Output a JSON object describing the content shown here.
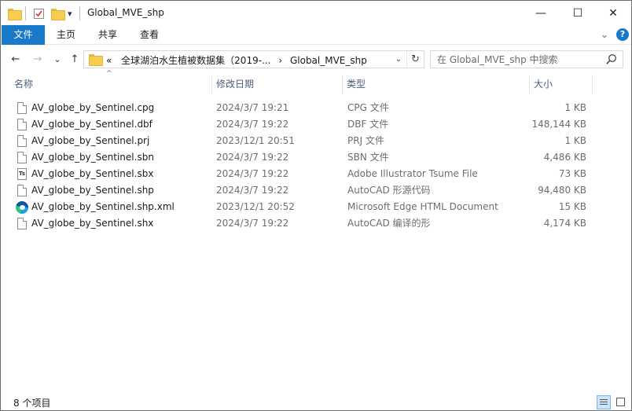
{
  "window": {
    "title": "Global_MVE_shp",
    "minimize_glyph": "—",
    "maximize_glyph": "☐",
    "close_glyph": "✕",
    "help_glyph": "?",
    "collapse_glyph": "⌄"
  },
  "quick_access": {
    "dropdown_glyph": "▾"
  },
  "ribbon": {
    "tabs": [
      "文件",
      "主页",
      "共享",
      "查看"
    ]
  },
  "nav": {
    "back_glyph": "←",
    "forward_glyph": "→",
    "recent_glyph": "⌄",
    "up_glyph": "↑",
    "breadcrumb_overflow": "«",
    "breadcrumb_parent": "全球湖泊水生植被数据集（2019-...",
    "breadcrumb_sep": "›",
    "breadcrumb_current": "Global_MVE_shp",
    "dropdown_glyph": "⌄",
    "refresh_glyph": "↻"
  },
  "search": {
    "placeholder": "在 Global_MVE_shp 中搜索"
  },
  "columns": {
    "name": "名称",
    "date": "修改日期",
    "type": "类型",
    "size": "大小",
    "sort_glyph": "^"
  },
  "files": [
    {
      "name": "AV_globe_by_Sentinel.cpg",
      "date": "2024/3/7 19:21",
      "type": "CPG 文件",
      "size": "1 KB",
      "icon": "file-icon"
    },
    {
      "name": "AV_globe_by_Sentinel.dbf",
      "date": "2024/3/7 19:22",
      "type": "DBF 文件",
      "size": "148,144 KB",
      "icon": "file-icon"
    },
    {
      "name": "AV_globe_by_Sentinel.prj",
      "date": "2023/12/1 20:51",
      "type": "PRJ 文件",
      "size": "1 KB",
      "icon": "file-icon"
    },
    {
      "name": "AV_globe_by_Sentinel.sbn",
      "date": "2024/3/7 19:22",
      "type": "SBN 文件",
      "size": "4,486 KB",
      "icon": "file-icon"
    },
    {
      "name": "AV_globe_by_Sentinel.sbx",
      "date": "2024/3/7 19:22",
      "type": "Adobe Illustrator Tsume File",
      "size": "73 KB",
      "icon": "illustrator-file-icon"
    },
    {
      "name": "AV_globe_by_Sentinel.shp",
      "date": "2024/3/7 19:22",
      "type": "AutoCAD 形源代码",
      "size": "94,480 KB",
      "icon": "file-icon"
    },
    {
      "name": "AV_globe_by_Sentinel.shp.xml",
      "date": "2023/12/1 20:52",
      "type": "Microsoft Edge HTML Document",
      "size": "15 KB",
      "icon": "edge-icon"
    },
    {
      "name": "AV_globe_by_Sentinel.shx",
      "date": "2024/3/7 19:22",
      "type": "AutoCAD 编译的形",
      "size": "4,174 KB",
      "icon": "file-icon"
    }
  ],
  "status": {
    "item_count": "8 个项目"
  },
  "colors": {
    "accent": "#1979ca",
    "header_text": "#4c607a",
    "folder": "#f7cd4f"
  }
}
